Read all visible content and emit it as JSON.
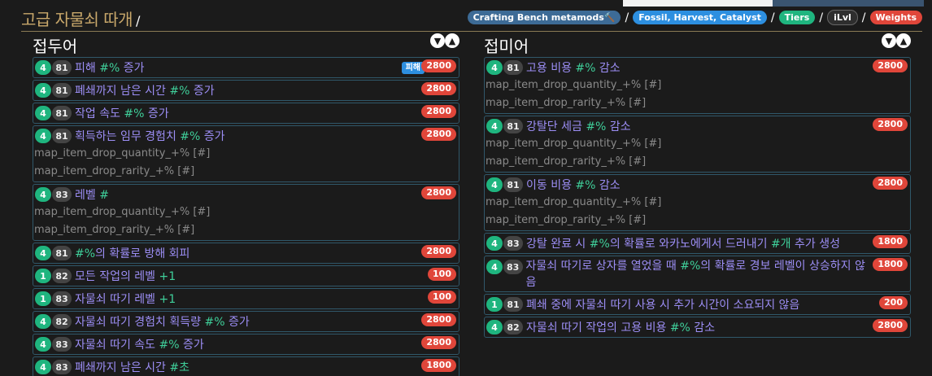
{
  "page": {
    "title": "고급 자물쇠 따개",
    "slash": "/"
  },
  "filters": [
    {
      "label": "Crafting Bench metamods🔨",
      "style": "gray"
    },
    {
      "label": "Fossil, Harvest, Catalyst",
      "style": "blue"
    },
    {
      "label": "Tiers",
      "style": "green"
    },
    {
      "label": "iLvl",
      "style": "dark"
    },
    {
      "label": "Weights",
      "style": "red"
    }
  ],
  "filter_separator": "/",
  "prefix": {
    "title": "접두어",
    "expand_icon": "chevron-down-icon",
    "collapse_icon": "chevron-up-icon",
    "mods": [
      {
        "tier": "4",
        "ilvl": "81",
        "text": "피해 ",
        "hash": "#%",
        "text2": " 증가",
        "weight": "2800",
        "tag": "피해",
        "stats": []
      },
      {
        "tier": "4",
        "ilvl": "81",
        "text": "폐쇄까지 남은 시간 ",
        "hash": "#%",
        "text2": " 증가",
        "weight": "2800",
        "stats": []
      },
      {
        "tier": "4",
        "ilvl": "81",
        "text": "작업 속도 ",
        "hash": "#%",
        "text2": " 증가",
        "weight": "2800",
        "stats": []
      },
      {
        "tier": "4",
        "ilvl": "81",
        "text": "획득하는 임무 경험치 ",
        "hash": "#%",
        "text2": " 증가",
        "weight": "2800",
        "stats": [
          "map_item_drop_quantity_+% [#]",
          "map_item_drop_rarity_+% [#]"
        ]
      },
      {
        "tier": "4",
        "ilvl": "83",
        "text": "레벨 ",
        "hash": "#",
        "text2": "",
        "weight": "2800",
        "stats": [
          "map_item_drop_quantity_+% [#]",
          "map_item_drop_rarity_+% [#]"
        ]
      },
      {
        "tier": "4",
        "ilvl": "81",
        "text": "",
        "hash": "#%",
        "text2": "의 확률로 방해 회피",
        "weight": "2800",
        "stats": []
      },
      {
        "tier": "1",
        "ilvl": "82",
        "text": "모든 작업의 레벨 ",
        "hash": "+1",
        "text2": "",
        "weight": "100",
        "stats": []
      },
      {
        "tier": "1",
        "ilvl": "83",
        "text": "자물쇠 따기 레벨 ",
        "hash": "+1",
        "text2": "",
        "weight": "100",
        "stats": []
      },
      {
        "tier": "4",
        "ilvl": "82",
        "text": "자물쇠 따기 경험치 획득량 ",
        "hash": "#%",
        "text2": " 증가",
        "weight": "2800",
        "stats": []
      },
      {
        "tier": "4",
        "ilvl": "83",
        "text": "자물쇠 따기 속도 ",
        "hash": "#%",
        "text2": " 증가",
        "weight": "2800",
        "stats": []
      },
      {
        "tier": "4",
        "ilvl": "83",
        "text": "폐쇄까지 남은 시간 ",
        "hash": "#초",
        "text2": "",
        "weight": "1800",
        "stats": []
      }
    ]
  },
  "suffix": {
    "title": "접미어",
    "expand_icon": "chevron-down-icon",
    "collapse_icon": "chevron-up-icon",
    "mods": [
      {
        "tier": "4",
        "ilvl": "81",
        "text": "고용 비용 ",
        "hash": "#%",
        "text2": " 감소",
        "weight": "2800",
        "stats": [
          "map_item_drop_quantity_+% [#]",
          "map_item_drop_rarity_+% [#]"
        ]
      },
      {
        "tier": "4",
        "ilvl": "81",
        "text": "강탈단 세금 ",
        "hash": "#%",
        "text2": " 감소",
        "weight": "2800",
        "stats": [
          "map_item_drop_quantity_+% [#]",
          "map_item_drop_rarity_+% [#]"
        ]
      },
      {
        "tier": "4",
        "ilvl": "81",
        "text": "이동 비용 ",
        "hash": "#%",
        "text2": " 감소",
        "weight": "2800",
        "stats": [
          "map_item_drop_quantity_+% [#]",
          "map_item_drop_rarity_+% [#]"
        ]
      },
      {
        "tier": "4",
        "ilvl": "83",
        "text": "강탈 완료 시 ",
        "hash": "#%",
        "text2": "의 확률로 와카노에게서 드러내기 ",
        "hash2": "#개",
        "text3": " 추가 생성",
        "weight": "1800",
        "stats": []
      },
      {
        "tier": "4",
        "ilvl": "83",
        "text": "자물쇠 따기로 상자를 열었을 때 ",
        "hash": "#%",
        "text2": "의 확률로 경보 레벨이 상승하지 않음",
        "weight": "1800",
        "stats": [],
        "wrap": true
      },
      {
        "tier": "1",
        "ilvl": "81",
        "text": "폐쇄 중에 자물쇠 따기 사용 시 추가 시간이 소요되지 않음",
        "hash": "",
        "text2": "",
        "weight": "200",
        "stats": []
      },
      {
        "tier": "4",
        "ilvl": "82",
        "text": "자물쇠 따기 작업의 고용 비용 ",
        "hash": "#%",
        "text2": " 감소",
        "weight": "2800",
        "stats": []
      }
    ]
  }
}
